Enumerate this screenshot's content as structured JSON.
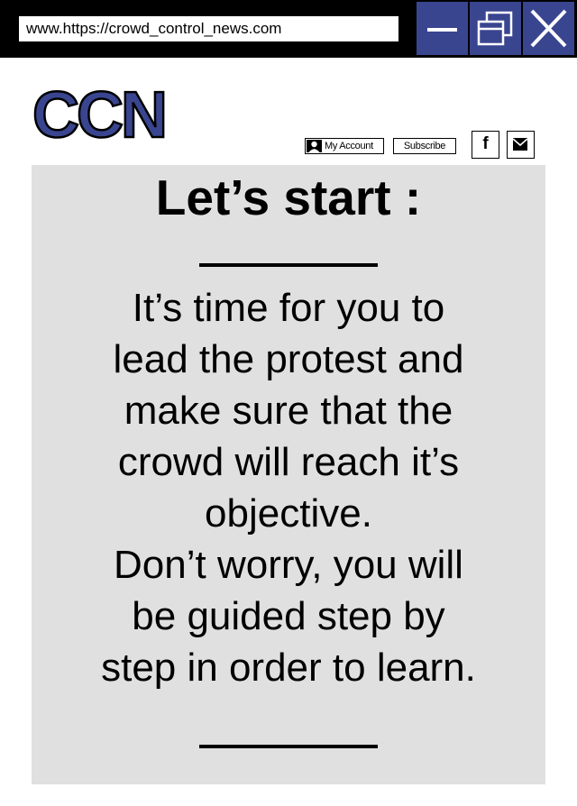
{
  "browser": {
    "url": "www.https://crowd_control_news.com",
    "window_controls": {
      "minimize_icon": "minimize-icon",
      "maximize_icon": "maximize-icon",
      "close_icon": "close-icon"
    }
  },
  "header": {
    "logo": "CCN",
    "my_account_label": "My Account",
    "subscribe_label": "Subscribe",
    "facebook_glyph": "f",
    "icons": [
      "user-icon",
      "facebook-icon",
      "mail-icon"
    ]
  },
  "content": {
    "heading": "Let’s start :",
    "lines": [
      "It’s time for you to",
      "lead the protest and",
      "make sure that the",
      "crowd will reach it’s",
      "objective.",
      "Don’t worry, you will",
      "be guided step by",
      "step in order to learn."
    ]
  },
  "colors": {
    "accent": "#3a4590",
    "title_bar": "#000000",
    "panel": "#e0e0e0"
  }
}
